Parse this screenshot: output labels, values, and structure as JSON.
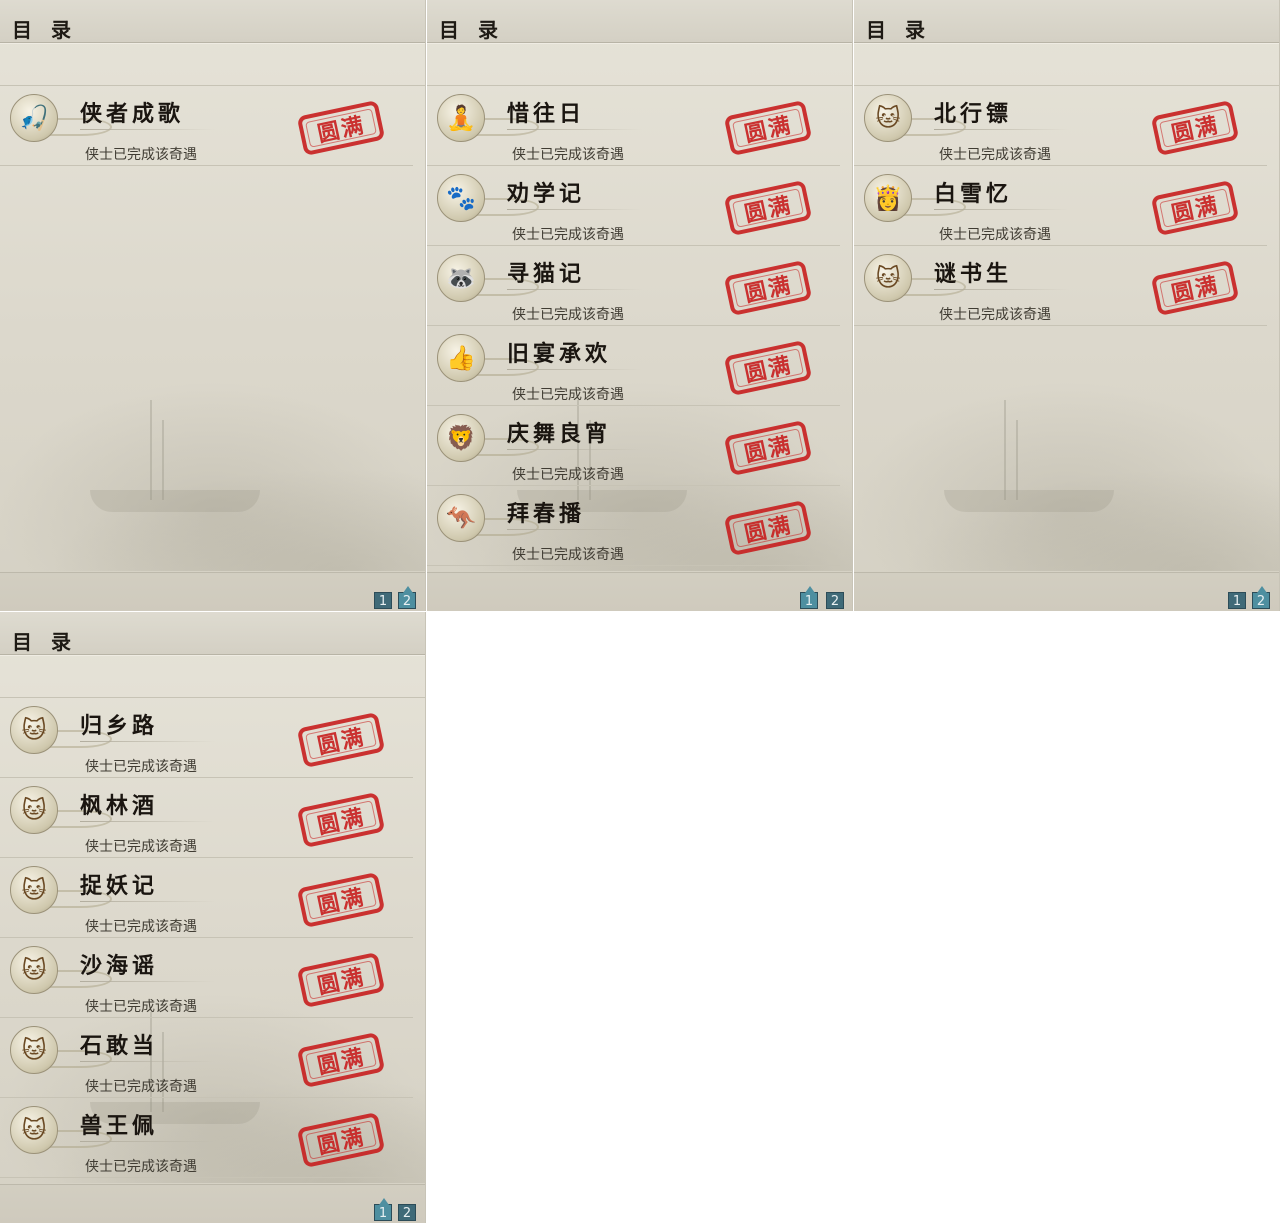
{
  "header_title": "目 录",
  "status_text": "侠士已完成该奇遇",
  "stamp_text": "圆满",
  "pages": [
    "1",
    "2"
  ],
  "panels": [
    {
      "active_page": 2,
      "items": [
        {
          "name": "侠者成歌",
          "icon": "fisherman-icon"
        }
      ]
    },
    {
      "active_page": 1,
      "items": [
        {
          "name": "惜往日",
          "icon": "buddha-icon"
        },
        {
          "name": "劝学记",
          "icon": "paw-icon"
        },
        {
          "name": "寻猫记",
          "icon": "raccoon-icon"
        },
        {
          "name": "旧宴承欢",
          "icon": "thumbs-up-icon"
        },
        {
          "name": "庆舞良宵",
          "icon": "lion-dance-icon"
        },
        {
          "name": "拜春播",
          "icon": "kangaroo-icon"
        }
      ]
    },
    {
      "active_page": 2,
      "items": [
        {
          "name": "北行镖",
          "icon": "cat-icon"
        },
        {
          "name": "白雪忆",
          "icon": "lady-icon"
        },
        {
          "name": "谜书生",
          "icon": "cat-icon"
        }
      ]
    },
    {
      "active_page": 1,
      "items": [
        {
          "name": "归乡路",
          "icon": "cat-icon"
        },
        {
          "name": "枫林酒",
          "icon": "cat-icon"
        },
        {
          "name": "捉妖记",
          "icon": "cat-icon"
        },
        {
          "name": "沙海谣",
          "icon": "cat-icon"
        },
        {
          "name": "石敢当",
          "icon": "cat-icon"
        },
        {
          "name": "兽王佩",
          "icon": "cat-icon"
        }
      ]
    }
  ]
}
